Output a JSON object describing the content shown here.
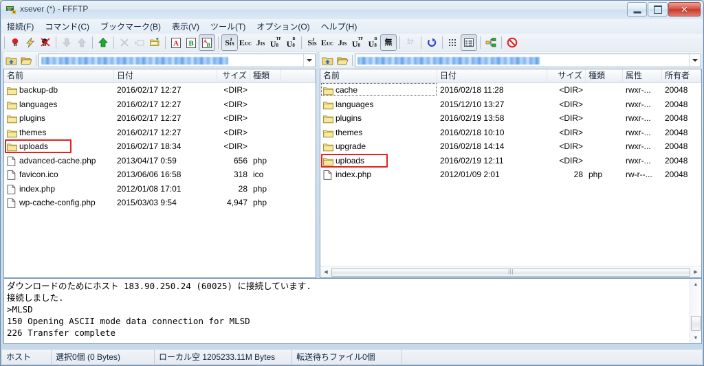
{
  "window": {
    "title": "xsever (*) - FFFTP",
    "app_icon": "ftp-app-icon",
    "controls": {
      "minimize": "Minimize",
      "maximize": "Maximize",
      "close": "Close"
    }
  },
  "menu": [
    {
      "label": "接続(F)",
      "key": "F"
    },
    {
      "label": "コマンド(C)",
      "key": "C"
    },
    {
      "label": "ブックマーク(B)",
      "key": "B"
    },
    {
      "label": "表示(V)",
      "key": "V"
    },
    {
      "label": "ツール(T)",
      "key": "T"
    },
    {
      "label": "オプション(O)",
      "key": "O"
    },
    {
      "label": "ヘルプ(H)",
      "key": "H"
    }
  ],
  "toolbar": {
    "groups": [
      {
        "buttons": [
          {
            "icon": "connect-plug-icon",
            "state": "enabled"
          },
          {
            "icon": "quick-connect-lightning-icon",
            "state": "enabled"
          },
          {
            "icon": "disconnect-icon",
            "state": "enabled"
          }
        ]
      },
      {
        "buttons": [
          {
            "icon": "download-arrow-icon",
            "state": "disabled"
          },
          {
            "icon": "upload-arrow-icon",
            "state": "disabled"
          }
        ]
      },
      {
        "buttons": [
          {
            "icon": "mirror-upload-icon",
            "state": "enabled"
          }
        ]
      },
      {
        "buttons": [
          {
            "icon": "delete-x-icon",
            "state": "disabled"
          },
          {
            "icon": "rename-icon",
            "state": "disabled"
          },
          {
            "icon": "new-folder-icon",
            "state": "enabled"
          }
        ]
      },
      {
        "buttons": [
          {
            "icon": "transfer-ascii-icon",
            "label": "A",
            "state": "enabled"
          },
          {
            "icon": "transfer-binary-icon",
            "label": "B",
            "state": "enabled"
          },
          {
            "icon": "transfer-auto-icon",
            "label": "AB",
            "state": "pressed"
          }
        ]
      },
      {
        "buttons": [
          {
            "icon": "encoding-sjis-icon",
            "label": "S",
            "sub": "JIS",
            "state": "pressed"
          },
          {
            "icon": "encoding-euc-icon",
            "label": "E",
            "sub": "UC",
            "state": "enabled"
          },
          {
            "icon": "encoding-jis-icon",
            "label": "J",
            "sub": "IS",
            "state": "enabled"
          },
          {
            "icon": "encoding-utf8-icon",
            "label": "U",
            "sub": "8",
            "sup": "TF",
            "state": "enabled"
          },
          {
            "icon": "encoding-utf8b-icon",
            "label": "U",
            "sub": "8",
            "sup": "B",
            "state": "enabled"
          }
        ]
      },
      {
        "buttons": [
          {
            "icon": "encoding-host-sjis-icon",
            "label": "S",
            "sub": "JIS",
            "state": "enabled"
          },
          {
            "icon": "encoding-host-euc-icon",
            "label": "E",
            "sub": "UC",
            "state": "enabled"
          },
          {
            "icon": "encoding-host-jis-icon",
            "label": "J",
            "sub": "IS",
            "state": "enabled"
          },
          {
            "icon": "encoding-host-utf8-icon",
            "label": "U",
            "sub": "8",
            "sup": "TF",
            "state": "enabled"
          },
          {
            "icon": "encoding-host-utf8b-icon",
            "label": "U",
            "sub": "8",
            "sup": "B",
            "state": "enabled"
          },
          {
            "icon": "encoding-none-icon",
            "label": "無",
            "state": "pressed"
          }
        ]
      },
      {
        "buttons": [
          {
            "icon": "kana-convert-icon",
            "label": "ｶﾅ",
            "state": "disabled"
          }
        ]
      },
      {
        "buttons": [
          {
            "icon": "refresh-icon",
            "state": "enabled"
          }
        ]
      },
      {
        "buttons": [
          {
            "icon": "list-view-icon",
            "state": "enabled"
          },
          {
            "icon": "detail-view-icon",
            "state": "pressed"
          }
        ]
      },
      {
        "buttons": [
          {
            "icon": "sitemap-icon",
            "state": "enabled"
          }
        ]
      },
      {
        "buttons": [
          {
            "icon": "stop-icon",
            "state": "enabled"
          }
        ]
      }
    ]
  },
  "left_pane": {
    "name": "local-file-list",
    "path_toolbar": {
      "up_folder_icon": "up-folder-icon",
      "open_folder_icon": "open-folder-icon",
      "path_value": "",
      "path_redacted": true,
      "dropdown_icon": "chevron-down-icon"
    },
    "columns": [
      {
        "label": "名前",
        "align": "left"
      },
      {
        "label": "日付",
        "align": "left"
      },
      {
        "label": "サイズ",
        "align": "right"
      },
      {
        "label": "種類",
        "align": "left"
      },
      {
        "label": "",
        "align": "left"
      }
    ],
    "rows": [
      {
        "icon": "folder-icon",
        "name": "backup-db",
        "date": "2016/02/17 12:27",
        "size": "<DIR>",
        "type": "",
        "highlighted": false
      },
      {
        "icon": "folder-icon",
        "name": "languages",
        "date": "2016/02/17 12:27",
        "size": "<DIR>",
        "type": "",
        "highlighted": false
      },
      {
        "icon": "folder-icon",
        "name": "plugins",
        "date": "2016/02/17 12:27",
        "size": "<DIR>",
        "type": "",
        "highlighted": false
      },
      {
        "icon": "folder-icon",
        "name": "themes",
        "date": "2016/02/17 12:27",
        "size": "<DIR>",
        "type": "",
        "highlighted": false
      },
      {
        "icon": "folder-icon",
        "name": "uploads",
        "date": "2016/02/17 18:34",
        "size": "<DIR>",
        "type": "",
        "highlighted": true
      },
      {
        "icon": "file-icon",
        "name": "advanced-cache.php",
        "date": "2013/04/17  0:59",
        "size": "656",
        "type": "php",
        "highlighted": false
      },
      {
        "icon": "file-icon",
        "name": "favicon.ico",
        "date": "2013/06/06 16:58",
        "size": "318",
        "type": "ico",
        "highlighted": false
      },
      {
        "icon": "file-icon",
        "name": "index.php",
        "date": "2012/01/08 17:01",
        "size": "28",
        "type": "php",
        "highlighted": false
      },
      {
        "icon": "file-icon",
        "name": "wp-cache-config.php",
        "date": "2015/03/03  9:54",
        "size": "4,947",
        "type": "php",
        "highlighted": false
      }
    ]
  },
  "right_pane": {
    "name": "remote-file-list",
    "path_toolbar": {
      "up_folder_icon": "up-folder-icon",
      "open_folder_icon": "open-folder-icon",
      "path_value": "",
      "path_redacted": true,
      "dropdown_icon": "chevron-down-icon"
    },
    "columns": [
      {
        "label": "名前",
        "align": "left"
      },
      {
        "label": "日付",
        "align": "left"
      },
      {
        "label": "サイズ",
        "align": "right"
      },
      {
        "label": "種類",
        "align": "left"
      },
      {
        "label": "属性",
        "align": "left"
      },
      {
        "label": "所有者",
        "align": "left"
      }
    ],
    "rows": [
      {
        "icon": "folder-icon",
        "name": "cache",
        "date": "2016/02/18 11:28",
        "size": "<DIR>",
        "type": "",
        "attr": "rwxr-...",
        "owner": "20048",
        "highlighted": false,
        "focused": true
      },
      {
        "icon": "folder-icon",
        "name": "languages",
        "date": "2015/12/10 13:27",
        "size": "<DIR>",
        "type": "",
        "attr": "rwxr-...",
        "owner": "20048",
        "highlighted": false,
        "focused": false
      },
      {
        "icon": "folder-icon",
        "name": "plugins",
        "date": "2016/02/19 13:58",
        "size": "<DIR>",
        "type": "",
        "attr": "rwxr-...",
        "owner": "20048",
        "highlighted": false,
        "focused": false
      },
      {
        "icon": "folder-icon",
        "name": "themes",
        "date": "2016/02/18 10:10",
        "size": "<DIR>",
        "type": "",
        "attr": "rwxr-...",
        "owner": "20048",
        "highlighted": false,
        "focused": false
      },
      {
        "icon": "folder-icon",
        "name": "upgrade",
        "date": "2016/02/18 14:14",
        "size": "<DIR>",
        "type": "",
        "attr": "rwxr-...",
        "owner": "20048",
        "highlighted": false,
        "focused": false
      },
      {
        "icon": "folder-icon",
        "name": "uploads",
        "date": "2016/02/19 12:11",
        "size": "<DIR>",
        "type": "",
        "attr": "rwxr-...",
        "owner": "20048",
        "highlighted": true,
        "focused": false
      },
      {
        "icon": "file-icon",
        "name": "index.php",
        "date": "2012/01/09  2:01",
        "size": "28",
        "type": "php",
        "attr": "rw-r--...",
        "owner": "20048",
        "highlighted": false,
        "focused": false
      }
    ]
  },
  "log": {
    "lines": [
      "ダウンロードのためにホスト 183.90.250.24 (60025) に接続しています.",
      "接続しました.",
      ">MLSD",
      "150 Opening ASCII mode data connection for MLSD",
      "226 Transfer complete"
    ]
  },
  "statusbar": {
    "host": "ホスト",
    "selection": "選択0個 (0 Bytes)",
    "local_free": "ローカル空 1205233.11M Bytes",
    "queue": "転送待ちファイル0個"
  },
  "colors": {
    "highlight_red": "#e8201a",
    "folder_yellow": "#f5dd7e",
    "title_blue": "#21374e",
    "pane_border": "#7f9db9"
  }
}
